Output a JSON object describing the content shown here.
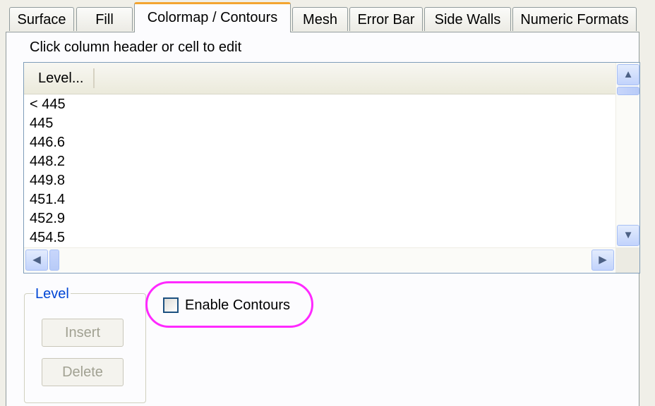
{
  "tabs": [
    {
      "label": "Surface",
      "active": false
    },
    {
      "label": "Fill",
      "active": false
    },
    {
      "label": "Colormap / Contours",
      "active": true
    },
    {
      "label": "Mesh",
      "active": false
    },
    {
      "label": "Error Bar",
      "active": false
    },
    {
      "label": "Side Walls",
      "active": false
    },
    {
      "label": "Numeric Formats",
      "active": false
    }
  ],
  "instruction": "Click column header or cell to edit",
  "grid": {
    "column_header": "Level...",
    "rows": [
      "< 445",
      "445",
      "446.6",
      "448.2",
      "449.8",
      "451.4",
      "452.9",
      "454.5"
    ]
  },
  "level_group": {
    "legend": "Level",
    "insert_label": "Insert",
    "delete_label": "Delete",
    "buttons_enabled": false
  },
  "contours": {
    "label": "Enable Contours",
    "checked": false
  },
  "icons": {
    "scroll_up": "chevron-up-icon",
    "scroll_down": "chevron-down-icon",
    "scroll_left": "chevron-left-icon",
    "scroll_right": "chevron-right-icon"
  },
  "colors": {
    "active_tab_accent": "#f3a531",
    "group_legend": "#0046d5",
    "highlight_ellipse": "#ff29ff",
    "scrollbar_button": "#c2d3fc"
  }
}
